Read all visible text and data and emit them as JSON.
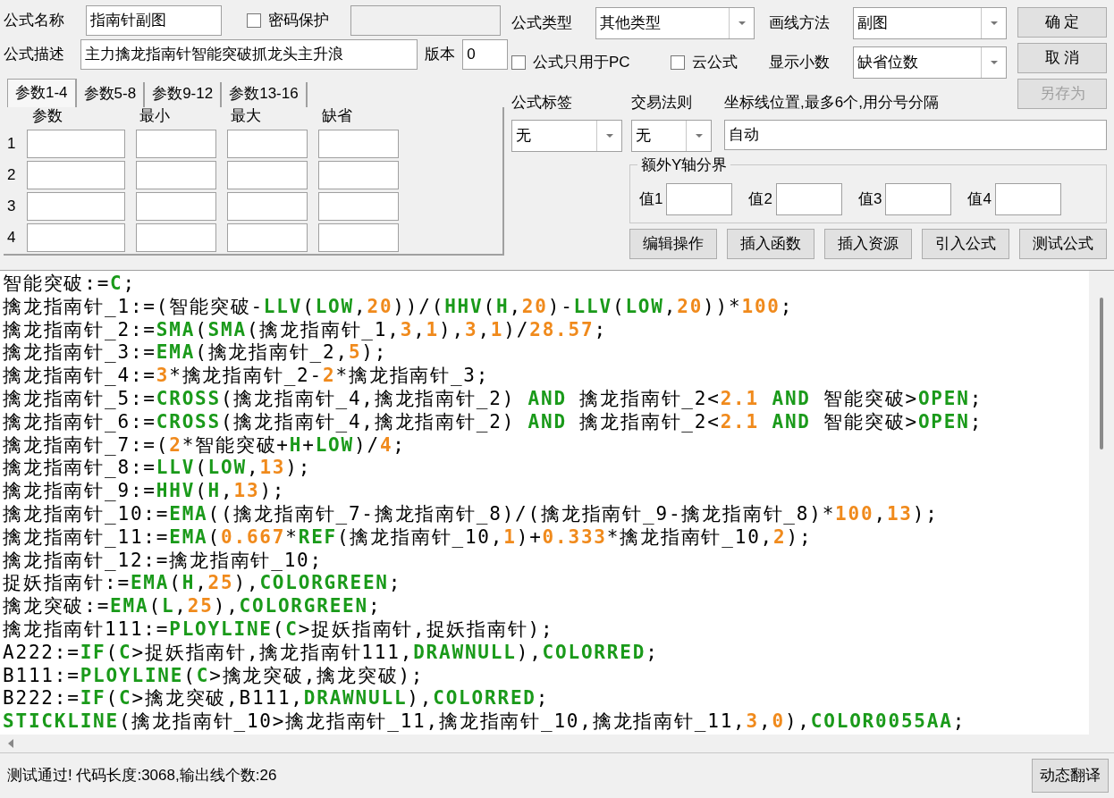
{
  "form": {
    "name_label": "公式名称",
    "name": "指南针副图",
    "password": {
      "label": "密码保护",
      "checked": false
    },
    "password_field": {
      "disabled": true
    },
    "desc_label": "公式描述",
    "description": "主力擒龙指南针智能突破抓龙头主升浪",
    "version_label": "版本",
    "version": "0"
  },
  "tabs": [
    {
      "label": "参数1-4",
      "selected": true
    },
    {
      "label": "参数5-8",
      "selected": false
    },
    {
      "label": "参数9-12",
      "selected": false
    },
    {
      "label": "参数13-16",
      "selected": false
    }
  ],
  "param_headers": [
    "参数",
    "最小",
    "最大",
    "缺省"
  ],
  "param_rows": [
    "1",
    "2",
    "3",
    "4"
  ],
  "settings": {
    "type_label": "公式类型",
    "type_value": "其他类型",
    "draw_label": "画线方法",
    "draw_value": "副图",
    "checkboxes": [
      {
        "label": "公式只用于PC",
        "checked": false
      },
      {
        "label": "云公式",
        "checked": false
      }
    ],
    "decimals_label": "显示小数",
    "decimals_value": "缺省位数",
    "tag_label": "公式标签",
    "tag_value": "无",
    "rule_label": "交易法则",
    "rule_value": "无",
    "axis_label": "坐标线位置,最多6个,用分号分隔",
    "axis_value": "自动"
  },
  "side_buttons": [
    {
      "label": "确 定",
      "disabled": false
    },
    {
      "label": "取 消",
      "disabled": false
    },
    {
      "label": "另存为",
      "disabled": true
    }
  ],
  "y_bounds": {
    "title": "额外Y轴分界",
    "labels": [
      "值1",
      "值2",
      "值3",
      "值4"
    ]
  },
  "actions": [
    "编辑操作",
    "插入函数",
    "插入资源",
    "引入公式",
    "测试公式"
  ],
  "code": [
    [
      {
        "kind": "plain",
        "text": "智能突破:="
      },
      {
        "kind": "func",
        "text": "C"
      },
      {
        "kind": "plain",
        "text": ";"
      }
    ],
    [
      {
        "kind": "plain",
        "text": "擒龙指南针_1:=(智能突破-"
      },
      {
        "kind": "func",
        "text": "LLV"
      },
      {
        "kind": "plain",
        "text": "("
      },
      {
        "kind": "func",
        "text": "LOW"
      },
      {
        "kind": "plain",
        "text": ","
      },
      {
        "kind": "num",
        "text": "20"
      },
      {
        "kind": "plain",
        "text": "))/("
      },
      {
        "kind": "func",
        "text": "HHV"
      },
      {
        "kind": "plain",
        "text": "("
      },
      {
        "kind": "func",
        "text": "H"
      },
      {
        "kind": "plain",
        "text": ","
      },
      {
        "kind": "num",
        "text": "20"
      },
      {
        "kind": "plain",
        "text": ")-"
      },
      {
        "kind": "func",
        "text": "LLV"
      },
      {
        "kind": "plain",
        "text": "("
      },
      {
        "kind": "func",
        "text": "LOW"
      },
      {
        "kind": "plain",
        "text": ","
      },
      {
        "kind": "num",
        "text": "20"
      },
      {
        "kind": "plain",
        "text": "))*"
      },
      {
        "kind": "num",
        "text": "100"
      },
      {
        "kind": "plain",
        "text": ";"
      }
    ],
    [
      {
        "kind": "plain",
        "text": "擒龙指南针_2:="
      },
      {
        "kind": "func",
        "text": "SMA"
      },
      {
        "kind": "plain",
        "text": "("
      },
      {
        "kind": "func",
        "text": "SMA"
      },
      {
        "kind": "plain",
        "text": "(擒龙指南针_1,"
      },
      {
        "kind": "num",
        "text": "3"
      },
      {
        "kind": "plain",
        "text": ","
      },
      {
        "kind": "num",
        "text": "1"
      },
      {
        "kind": "plain",
        "text": "),"
      },
      {
        "kind": "num",
        "text": "3"
      },
      {
        "kind": "plain",
        "text": ","
      },
      {
        "kind": "num",
        "text": "1"
      },
      {
        "kind": "plain",
        "text": ")/"
      },
      {
        "kind": "num",
        "text": "28.57"
      },
      {
        "kind": "plain",
        "text": ";"
      }
    ],
    [
      {
        "kind": "plain",
        "text": "擒龙指南针_3:="
      },
      {
        "kind": "func",
        "text": "EMA"
      },
      {
        "kind": "plain",
        "text": "(擒龙指南针_2,"
      },
      {
        "kind": "num",
        "text": "5"
      },
      {
        "kind": "plain",
        "text": ");"
      }
    ],
    [
      {
        "kind": "plain",
        "text": "擒龙指南针_4:="
      },
      {
        "kind": "num",
        "text": "3"
      },
      {
        "kind": "plain",
        "text": "*擒龙指南针_2-"
      },
      {
        "kind": "num",
        "text": "2"
      },
      {
        "kind": "plain",
        "text": "*擒龙指南针_3;"
      }
    ],
    [
      {
        "kind": "plain",
        "text": "擒龙指南针_5:="
      },
      {
        "kind": "func",
        "text": "CROSS"
      },
      {
        "kind": "plain",
        "text": "(擒龙指南针_4,擒龙指南针_2) "
      },
      {
        "kind": "func",
        "text": "AND"
      },
      {
        "kind": "plain",
        "text": " 擒龙指南针_2<"
      },
      {
        "kind": "num",
        "text": "2.1"
      },
      {
        "kind": "func",
        "text": " AND"
      },
      {
        "kind": "plain",
        "text": " 智能突破>"
      },
      {
        "kind": "func",
        "text": "OPEN"
      },
      {
        "kind": "plain",
        "text": ";"
      }
    ],
    [
      {
        "kind": "plain",
        "text": "擒龙指南针_6:="
      },
      {
        "kind": "func",
        "text": "CROSS"
      },
      {
        "kind": "plain",
        "text": "(擒龙指南针_4,擒龙指南针_2) "
      },
      {
        "kind": "func",
        "text": "AND"
      },
      {
        "kind": "plain",
        "text": " 擒龙指南针_2<"
      },
      {
        "kind": "num",
        "text": "2.1"
      },
      {
        "kind": "func",
        "text": " AND"
      },
      {
        "kind": "plain",
        "text": " 智能突破>"
      },
      {
        "kind": "func",
        "text": "OPEN"
      },
      {
        "kind": "plain",
        "text": ";"
      }
    ],
    [
      {
        "kind": "plain",
        "text": "擒龙指南针_7:=("
      },
      {
        "kind": "num",
        "text": "2"
      },
      {
        "kind": "plain",
        "text": "*智能突破+"
      },
      {
        "kind": "func",
        "text": "H"
      },
      {
        "kind": "plain",
        "text": "+"
      },
      {
        "kind": "func",
        "text": "LOW"
      },
      {
        "kind": "plain",
        "text": ")/"
      },
      {
        "kind": "num",
        "text": "4"
      },
      {
        "kind": "plain",
        "text": ";"
      }
    ],
    [
      {
        "kind": "plain",
        "text": "擒龙指南针_8:="
      },
      {
        "kind": "func",
        "text": "LLV"
      },
      {
        "kind": "plain",
        "text": "("
      },
      {
        "kind": "func",
        "text": "LOW"
      },
      {
        "kind": "plain",
        "text": ","
      },
      {
        "kind": "num",
        "text": "13"
      },
      {
        "kind": "plain",
        "text": ");"
      }
    ],
    [
      {
        "kind": "plain",
        "text": "擒龙指南针_9:="
      },
      {
        "kind": "func",
        "text": "HHV"
      },
      {
        "kind": "plain",
        "text": "("
      },
      {
        "kind": "func",
        "text": "H"
      },
      {
        "kind": "plain",
        "text": ","
      },
      {
        "kind": "num",
        "text": "13"
      },
      {
        "kind": "plain",
        "text": ");"
      }
    ],
    [
      {
        "kind": "plain",
        "text": "擒龙指南针_10:="
      },
      {
        "kind": "func",
        "text": "EMA"
      },
      {
        "kind": "plain",
        "text": "((擒龙指南针_7-擒龙指南针_8)/(擒龙指南针_9-擒龙指南针_8)*"
      },
      {
        "kind": "num",
        "text": "100"
      },
      {
        "kind": "plain",
        "text": ","
      },
      {
        "kind": "num",
        "text": "13"
      },
      {
        "kind": "plain",
        "text": ");"
      }
    ],
    [
      {
        "kind": "plain",
        "text": "擒龙指南针_11:="
      },
      {
        "kind": "func",
        "text": "EMA"
      },
      {
        "kind": "plain",
        "text": "("
      },
      {
        "kind": "num",
        "text": "0.667"
      },
      {
        "kind": "plain",
        "text": "*"
      },
      {
        "kind": "func",
        "text": "REF"
      },
      {
        "kind": "plain",
        "text": "(擒龙指南针_10,"
      },
      {
        "kind": "num",
        "text": "1"
      },
      {
        "kind": "plain",
        "text": ")+"
      },
      {
        "kind": "num",
        "text": "0.333"
      },
      {
        "kind": "plain",
        "text": "*擒龙指南针_10,"
      },
      {
        "kind": "num",
        "text": "2"
      },
      {
        "kind": "plain",
        "text": ");"
      }
    ],
    [
      {
        "kind": "plain",
        "text": "擒龙指南针_12:=擒龙指南针_10;"
      }
    ],
    [
      {
        "kind": "plain",
        "text": "捉妖指南针:="
      },
      {
        "kind": "func",
        "text": "EMA"
      },
      {
        "kind": "plain",
        "text": "("
      },
      {
        "kind": "func",
        "text": "H"
      },
      {
        "kind": "plain",
        "text": ","
      },
      {
        "kind": "num",
        "text": "25"
      },
      {
        "kind": "plain",
        "text": "),"
      },
      {
        "kind": "func",
        "text": "COLORGREEN"
      },
      {
        "kind": "plain",
        "text": ";"
      }
    ],
    [
      {
        "kind": "plain",
        "text": "擒龙突破:="
      },
      {
        "kind": "func",
        "text": "EMA"
      },
      {
        "kind": "plain",
        "text": "("
      },
      {
        "kind": "func",
        "text": "L"
      },
      {
        "kind": "plain",
        "text": ","
      },
      {
        "kind": "num",
        "text": "25"
      },
      {
        "kind": "plain",
        "text": "),"
      },
      {
        "kind": "func",
        "text": "COLORGREEN"
      },
      {
        "kind": "plain",
        "text": ";"
      }
    ],
    [
      {
        "kind": "plain",
        "text": "擒龙指南针111:="
      },
      {
        "kind": "func",
        "text": "PLOYLINE"
      },
      {
        "kind": "plain",
        "text": "("
      },
      {
        "kind": "func",
        "text": "C"
      },
      {
        "kind": "plain",
        "text": ">捉妖指南针,捉妖指南针);"
      }
    ],
    [
      {
        "kind": "plain",
        "text": "A222:="
      },
      {
        "kind": "func",
        "text": "IF"
      },
      {
        "kind": "plain",
        "text": "("
      },
      {
        "kind": "func",
        "text": "C"
      },
      {
        "kind": "plain",
        "text": ">捉妖指南针,擒龙指南针111,"
      },
      {
        "kind": "func",
        "text": "DRAWNULL"
      },
      {
        "kind": "plain",
        "text": "),"
      },
      {
        "kind": "func",
        "text": "COLORRED"
      },
      {
        "kind": "plain",
        "text": ";"
      }
    ],
    [
      {
        "kind": "plain",
        "text": "B111:="
      },
      {
        "kind": "func",
        "text": "PLOYLINE"
      },
      {
        "kind": "plain",
        "text": "("
      },
      {
        "kind": "func",
        "text": "C"
      },
      {
        "kind": "plain",
        "text": ">擒龙突破,擒龙突破);"
      }
    ],
    [
      {
        "kind": "plain",
        "text": "B222:="
      },
      {
        "kind": "func",
        "text": "IF"
      },
      {
        "kind": "plain",
        "text": "("
      },
      {
        "kind": "func",
        "text": "C"
      },
      {
        "kind": "plain",
        "text": ">擒龙突破,B111,"
      },
      {
        "kind": "func",
        "text": "DRAWNULL"
      },
      {
        "kind": "plain",
        "text": "),"
      },
      {
        "kind": "func",
        "text": "COLORRED"
      },
      {
        "kind": "plain",
        "text": ";"
      }
    ],
    [
      {
        "kind": "func",
        "text": "STICKLINE"
      },
      {
        "kind": "plain",
        "text": "(擒龙指南针_10>擒龙指南针_11,擒龙指南针_10,擒龙指南针_11,"
      },
      {
        "kind": "num",
        "text": "3"
      },
      {
        "kind": "plain",
        "text": ","
      },
      {
        "kind": "num",
        "text": "0"
      },
      {
        "kind": "plain",
        "text": "),"
      },
      {
        "kind": "func",
        "text": "COLOR0055AA"
      },
      {
        "kind": "plain",
        "text": ";"
      }
    ]
  ],
  "status": "测试通过! 代码长度:3068,输出线个数:26",
  "translate_button": "动态翻译"
}
